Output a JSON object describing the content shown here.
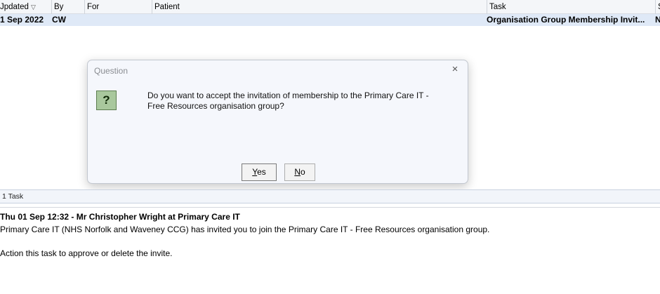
{
  "table": {
    "headers": {
      "updated": "Jpdated",
      "updated_sort_icon": "▽",
      "by": "By",
      "for": "For",
      "patient": "Patient",
      "task": "Task",
      "status": "S"
    },
    "row": {
      "updated": "1 Sep 2022",
      "by": "CW",
      "for": "",
      "patient": "",
      "task": "Organisation Group Membership Invit...",
      "status": "N"
    }
  },
  "dialog": {
    "title": "Question",
    "close_icon": "×",
    "icon_glyph": "?",
    "message_line1": "Do you want to accept the invitation of membership to the Primary Care IT -",
    "message_line2": "Free Resources organisation group?",
    "yes_mnemonic": "Y",
    "yes_rest": "es",
    "no_mnemonic": "N",
    "no_rest": "o"
  },
  "taskbar": {
    "count_label": "1 Task"
  },
  "detail": {
    "heading": "Thu 01 Sep 12:32 - Mr Christopher Wright at Primary Care IT",
    "line1": "Primary Care IT (NHS Norfolk and Waveney CCG)  has invited you to join the Primary Care IT - Free Resources organisation group.",
    "line2": "Action this task to approve or delete the invite."
  },
  "colors": {
    "header_bg": "#f4f6f9",
    "selected_row": "#dfe9f7",
    "dialog_bg": "#f5f7fc",
    "question_icon_bg": "#a9c89d"
  }
}
